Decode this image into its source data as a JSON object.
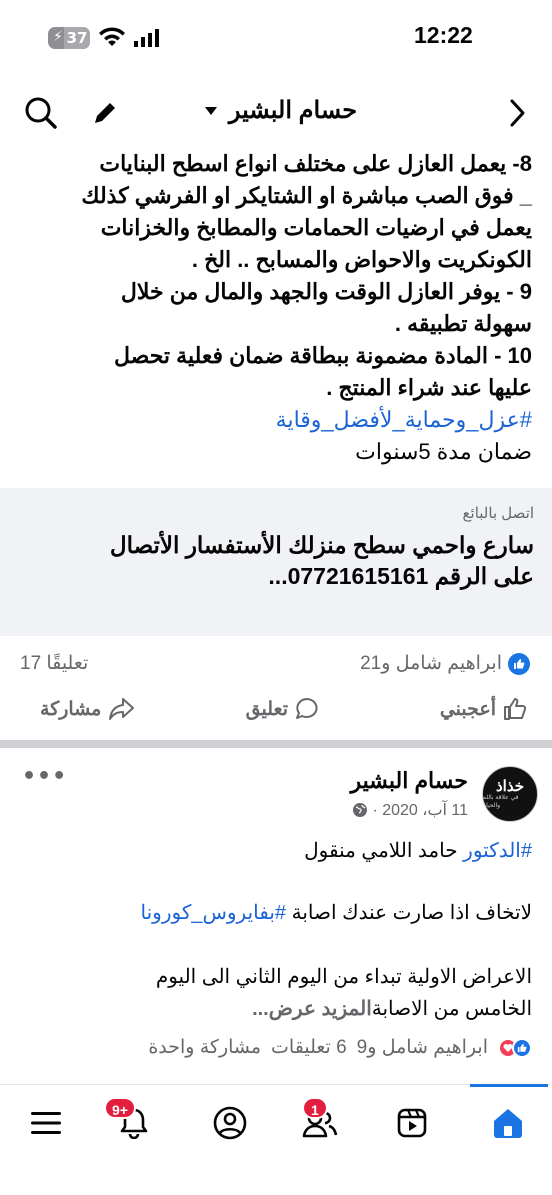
{
  "status_bar": {
    "time": "12:22",
    "battery": "37",
    "icons": [
      "battery-charging-icon",
      "wifi-icon",
      "signal-icon"
    ]
  },
  "topbar": {
    "title": "حسام البشير",
    "icons": [
      "search-icon",
      "edit-pencil-icon",
      "back-chevron-icon",
      "caret-down-icon"
    ]
  },
  "post": {
    "lines": [
      "8- يعمل العازل على مختلف انواع اسطح البنايات",
      "_ فوق الصب مباشرة او الشتايكر او الفرشي كذلك",
      "يعمل في ارضيات الحمامات والمطابخ والخزانات",
      "الكونكريت والاحواض والمسابح .. الخ .",
      "9 - يوفر العازل الوقت والجهد والمال من خلال",
      "سهولة تطبيقه .",
      "10 - المادة مضمونة ببطاقة ضمان فعلية تحصل",
      "عليها عند شراء المنتج ."
    ],
    "hashtag": "#عزل_وحماية_لأفضل_وقاية",
    "last_line": "ضمان مدة 5سنوات"
  },
  "seller": {
    "label": "اتصل بالبائع",
    "message_line1": "سارع واحمي سطح منزلك الأستفسار الأتصال",
    "message_line2": "على الرقم 07721615161..."
  },
  "reactions": {
    "likes_text": "ابراهيم شامل و21",
    "comments_text": "17 تعليقًا"
  },
  "actions": {
    "like": "أعجبني",
    "comment": "تعليق",
    "share": "مشاركة"
  },
  "post2": {
    "author": "حسام البشير",
    "date": "11 آب، 2020 ·",
    "avatar_text": "خذاذ",
    "avatar_subtext": "في علاقة بالله والحياة",
    "line1_tag": "#الدكتور",
    "line1_rest": " حامد اللامي   منقول",
    "line2_text": "لاتخاف اذا صارت عندك اصابة ",
    "line2_tag": "#بفايروس_كورونا",
    "line3": "الاعراض الاولية تبداء من اليوم الثاني الى اليوم",
    "line4_text": "الخامس من الاصابة",
    "line4_more": "المزيد عرض...",
    "reactions_text": "ابراهيم شامل و9",
    "comments_text": "6 تعليقات",
    "shares_text": "مشاركة واحدة"
  },
  "bottom_nav": {
    "items": [
      "menu-icon",
      "notifications-icon",
      "profile-icon",
      "friends-icon",
      "video-icon",
      "home-icon"
    ],
    "notifications_badge": "9+",
    "friends_badge": "1"
  },
  "colors": {
    "accent": "#1b74e4",
    "hashtag": "#1b63d6",
    "badge_red": "#e41e3f",
    "muted": "#65676b",
    "seller_bg": "#f0f2f5"
  }
}
